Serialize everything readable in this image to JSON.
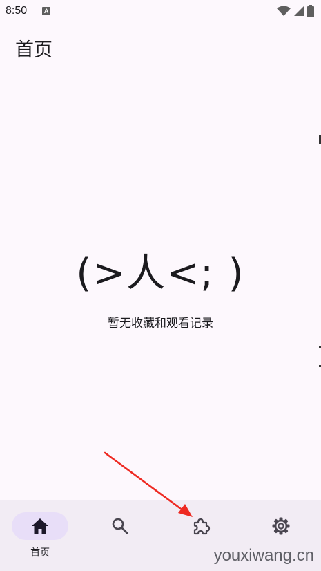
{
  "status_bar": {
    "time": "8:50",
    "notification_icon": "a-icon",
    "notification_letter": "A",
    "right_icons": [
      "wifi-icon",
      "signal-icon",
      "battery-icon"
    ]
  },
  "header": {
    "title": "首页"
  },
  "empty_state": {
    "kaomoji": "(>人<; )",
    "message": "暂无收藏和观看记录"
  },
  "bottom_nav": {
    "items": [
      {
        "icon": "home-icon",
        "label": "首页",
        "active": true
      },
      {
        "icon": "search-icon",
        "label": "",
        "active": false
      },
      {
        "icon": "extension-icon",
        "label": "",
        "active": false
      },
      {
        "icon": "settings-icon",
        "label": "",
        "active": false
      }
    ]
  },
  "annotation": {
    "arrow_color": "#ee2a22"
  },
  "watermark": {
    "text": "youxiwang.cn"
  },
  "colors": {
    "background": "#fdf8fd",
    "nav_background": "#f2ecf4",
    "active_indicator": "#e8def8",
    "text": "#1c1b1f"
  }
}
